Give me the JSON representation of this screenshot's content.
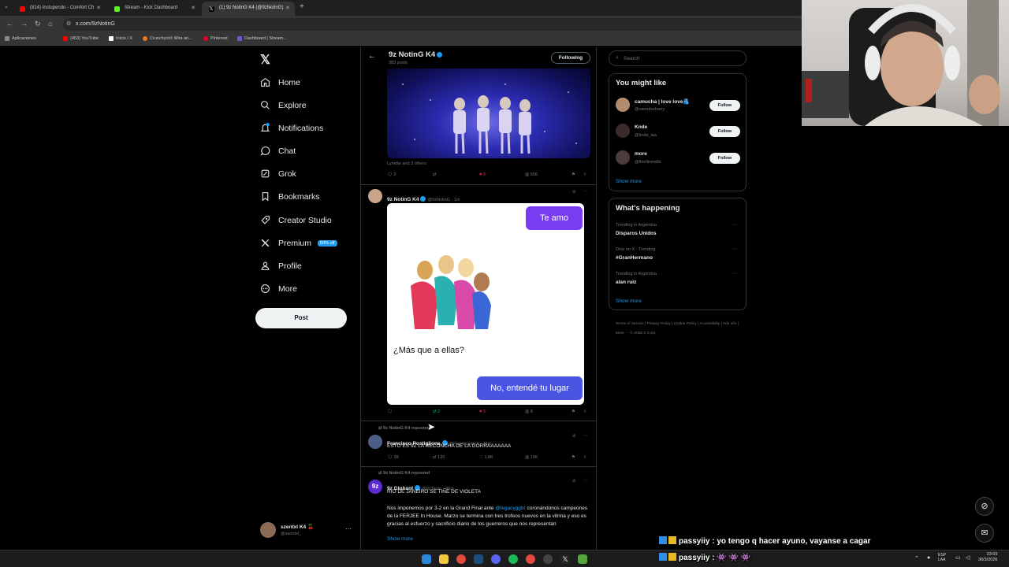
{
  "browser": {
    "tabs": [
      {
        "label": "(814) Instupendo - Comfort Ch",
        "color": "#ff0000"
      },
      {
        "label": "Stream - Kick Dashboard",
        "color": "#53fc18"
      },
      {
        "label": "(1) 9z NotinG K4 (@9zNotinG)",
        "color": "#ffffff"
      }
    ],
    "url": "x.com/9zNotinG",
    "bookmarks": [
      {
        "label": "Aplicaciones",
        "color": "#888888"
      },
      {
        "label": "(453) YouTube",
        "color": "#ff0000"
      },
      {
        "label": "Inicio / X",
        "color": "#ffffff"
      },
      {
        "label": "Crunchyroll: Mira an...",
        "color": "#f47521"
      },
      {
        "label": "Pinterest",
        "color": "#e60023"
      },
      {
        "label": "Dashboard | Stream...",
        "color": "#6a5acd"
      }
    ]
  },
  "nav": {
    "items": [
      {
        "label": "Home"
      },
      {
        "label": "Explore"
      },
      {
        "label": "Notifications"
      },
      {
        "label": "Chat"
      },
      {
        "label": "Grok"
      },
      {
        "label": "Bookmarks"
      },
      {
        "label": "Creator Studio"
      },
      {
        "label": "Premium"
      },
      {
        "label": "Profile"
      },
      {
        "label": "More"
      }
    ],
    "premium_badge": "50% off",
    "post_label": "Post",
    "account": {
      "name": "szentxl K4 🍒",
      "handle": "@sanntxl_"
    }
  },
  "profile_header": {
    "name": "9z NotinG K4",
    "posts": "383 posts",
    "following_label": "Following"
  },
  "first_post": {
    "liked_by": "Lynette and 3 others",
    "replies": "2",
    "likes": "3",
    "views": "656"
  },
  "post2": {
    "name": "9z NotinG K4",
    "meta": "@9zNotinG · 1m",
    "bubble_top": "Te amo",
    "question": "¿Más que a ellas?",
    "bubble_bottom": "No, entendé tu lugar",
    "retweets": "2",
    "likes": "3",
    "views": "8"
  },
  "post3": {
    "repost_label": "9z NotinG K4 reposted",
    "name": "Francisco Postiglione",
    "meta": "@FrankkasterX · 46m",
    "text": "ESTO ES 9Z LA RECONCHA DE LA GORRAAAAAAA",
    "replies": "38",
    "retweets": "120",
    "likes": "1.8K",
    "views": "10K"
  },
  "post4": {
    "repost_label": "9z NotinG K4 reposted",
    "name": "9z Globant",
    "meta": "@9zTeam · 46m",
    "line1": "RIO DE JANEIRO SE TIÑE DE VIOLETA",
    "para_pre": "Nos imponemos por 3-2 en la Grand Final ante ",
    "mention": "@legacyggbr",
    "para_post": " coronándonos campeones de la FERJEE In House. Marzo se termina con tres trofeos nuevos en la vitrina y eso es gracias al esfuerzo y sacrificio diario de los guerreros que nos representan",
    "show_more": "Show more"
  },
  "search": {
    "placeholder": "Search"
  },
  "you_might_like": {
    "title": "You might like",
    "users": [
      {
        "name": "camucha | love love🫂",
        "handle": "@camulvsharry",
        "follow": "Follow"
      },
      {
        "name": "Knde",
        "handle": "@knde_iaa",
        "follow": "Follow"
      },
      {
        "name": "more",
        "handle": "@finellinewlls",
        "follow": "Follow"
      }
    ],
    "show_more": "Show more"
  },
  "whats_happening": {
    "title": "What's happening",
    "trends": [
      {
        "context": "Trending in Argentina",
        "topic": "Disparos Unidos"
      },
      {
        "context": "Only on X · Trending",
        "topic": "#GranHermano"
      },
      {
        "context": "Trending in Argentina",
        "topic": "alan ruiz"
      }
    ],
    "show_more": "Show more"
  },
  "footer_links": [
    "Terms of Service",
    "|",
    "Privacy Policy",
    "|",
    "Cookie Policy",
    "|",
    "Accessibility",
    "|",
    "Ads info",
    "|",
    "More ···",
    "© 2026 X Corp."
  ],
  "chat_overlay": [
    {
      "text": "passyiiy : yo tengo q hacer ayuno, vayanse a cagar"
    },
    {
      "text": "passyiiy : 👾 👾 👾"
    }
  ],
  "taskbar": {
    "lang": "ESP\nLAA",
    "time": "23:03",
    "date": "30/3/2026"
  }
}
